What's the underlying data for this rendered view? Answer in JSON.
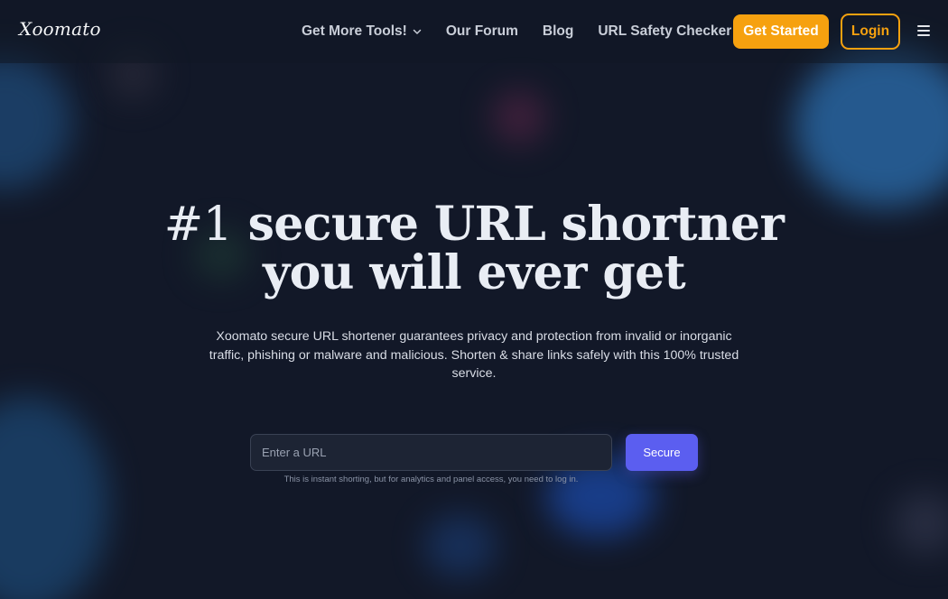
{
  "header": {
    "logo": "Xoomato",
    "nav": [
      {
        "label": "Get More Tools!",
        "has_dropdown": true
      },
      {
        "label": "Our Forum"
      },
      {
        "label": "Blog"
      },
      {
        "label": "URL Safety Checker"
      }
    ],
    "get_started_label": "Get Started",
    "login_label": "Login",
    "menu_icon": "hamburger-icon"
  },
  "hero": {
    "title_hash": "#1",
    "title_line1_rest": " secure URL shortner",
    "title_line2": "you will ever get",
    "subtitle": "Xoomato secure URL shortener guarantees privacy and protection from invalid or inorganic traffic, phishing or malware and malicious. Shorten & share links safely with this 100% trusted service."
  },
  "form": {
    "url_placeholder": "Enter a URL",
    "url_value": "",
    "submit_label": "Secure",
    "hint": "This is instant shorting, but for analytics and panel access, you need to log in."
  },
  "colors": {
    "background": "#121828",
    "accent": "#f6a10f",
    "button": "#5b5ef0"
  }
}
